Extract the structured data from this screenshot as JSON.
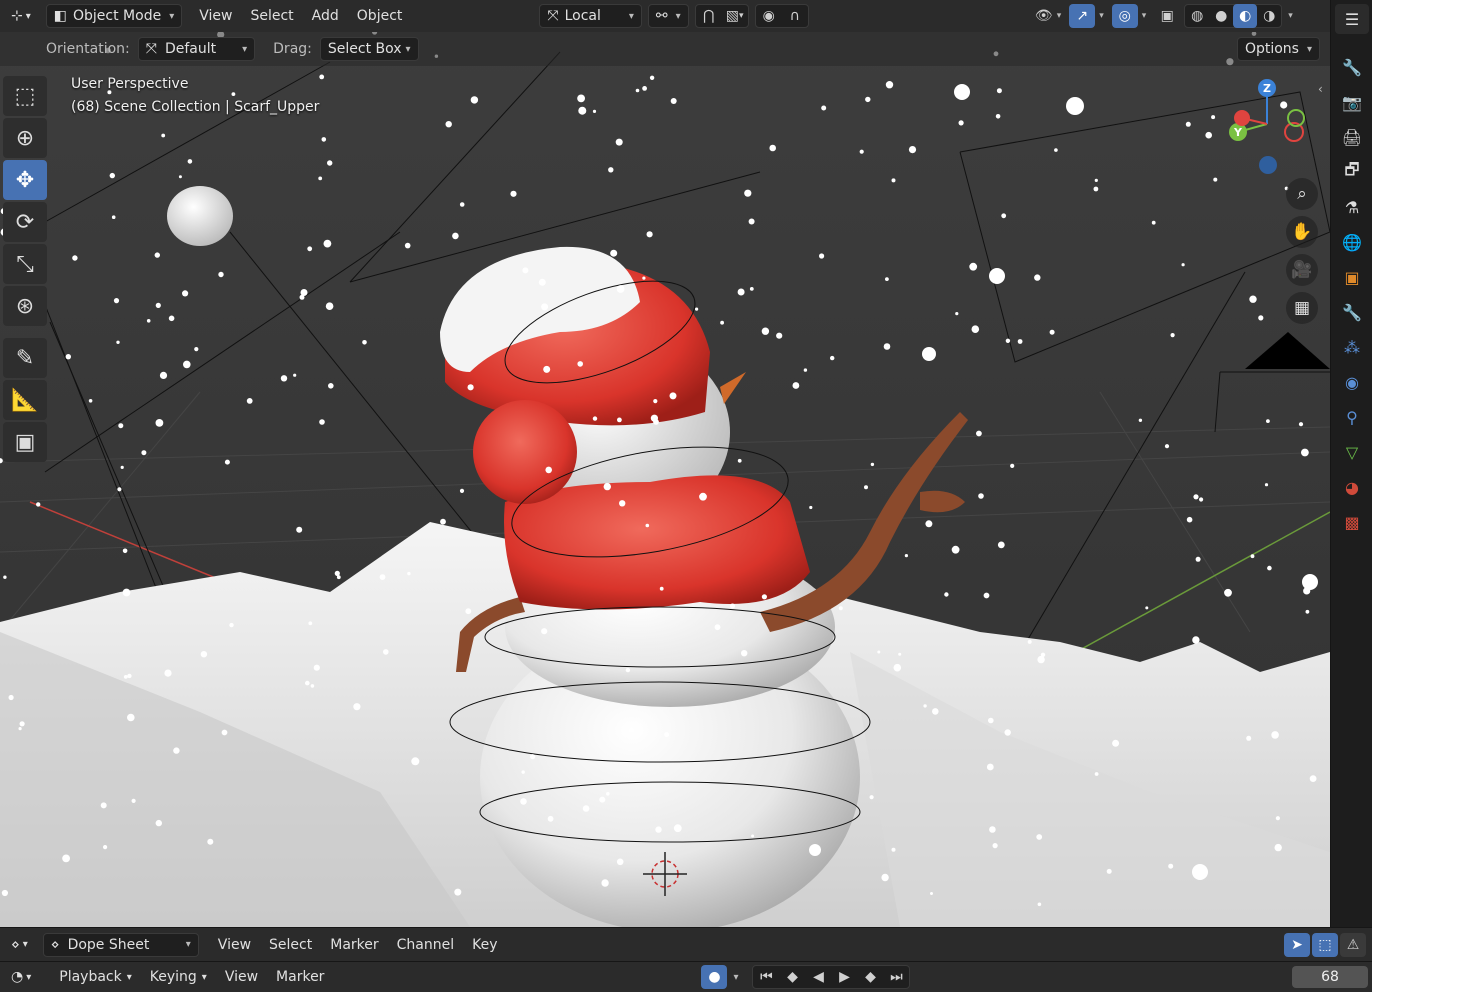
{
  "header": {
    "editor_icon": "viewport-editor-icon",
    "mode": "Object Mode",
    "menus": [
      "View",
      "Select",
      "Add",
      "Object"
    ],
    "transform_space": "Local",
    "shading_icons": [
      "wireframe-icon",
      "solid-icon",
      "material-icon",
      "rendered-icon"
    ]
  },
  "subheader": {
    "orientation_label": "Orientation:",
    "orientation_value": "Default",
    "drag_label": "Drag:",
    "drag_value": "Select Box",
    "options_label": "Options"
  },
  "viewport": {
    "perspective": "User Perspective",
    "collection_info": "(68) Scene Collection | Scarf_Upper",
    "gizmo": {
      "z": "Z",
      "y": "Y",
      "x": "X"
    }
  },
  "toolbar": {
    "tools": [
      "select-box",
      "cursor",
      "move",
      "rotate",
      "scale",
      "transform",
      "annotate",
      "measure",
      "add-cube"
    ],
    "active": "move"
  },
  "properties_tabs": [
    "tool",
    "render",
    "output",
    "view-layer",
    "scene",
    "world",
    "object",
    "modifiers",
    "particles",
    "physics",
    "constraints",
    "data",
    "material",
    "texture"
  ],
  "dope_sheet": {
    "mode": "Dope Sheet",
    "menus": [
      "View",
      "Select",
      "Marker",
      "Channel",
      "Key"
    ]
  },
  "timeline": {
    "menus": [
      "Playback",
      "Keying",
      "View",
      "Marker"
    ],
    "current_frame": "68"
  },
  "colors": {
    "accent": "#4772b3",
    "axis_x": "#e0443f",
    "axis_y": "#7ac142",
    "axis_z": "#3b82d8",
    "hat_red": "#d9342b",
    "snow": "#f2f2f2"
  }
}
